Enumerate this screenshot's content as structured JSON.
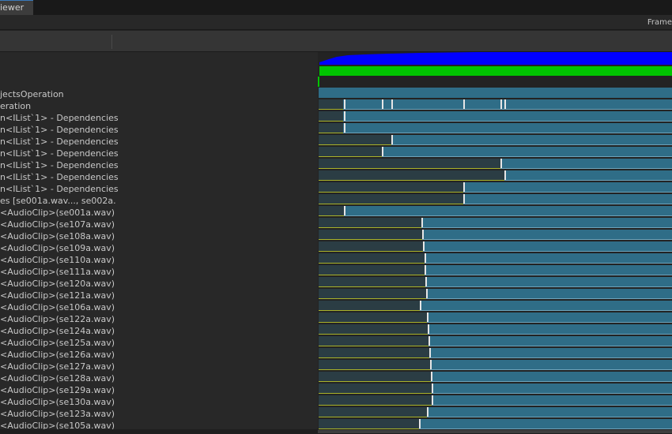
{
  "window": {
    "tab_title": "iewer",
    "frame_label": "Frame"
  },
  "colors": {
    "blue": "#0000ff",
    "green": "#00c400",
    "bar": "#2f6d87",
    "dark": "#2b3d44",
    "olive": "#aab32a"
  },
  "rows": [
    {
      "label": "jectsOperation",
      "end": 1.0,
      "ticks": []
    },
    {
      "label": "eration",
      "end": 1.0,
      "dark": 0.07,
      "ticks": [
        0.072,
        0.18,
        0.205,
        0.41,
        0.515,
        0.525
      ]
    },
    {
      "label": "n<IList`1> - Dependencies",
      "end": 1.0,
      "dark": 0.07,
      "ticks": [
        0.072
      ]
    },
    {
      "label": "n<IList`1> - Dependencies",
      "end": 1.0,
      "dark": 0.07,
      "ticks": [
        0.072
      ]
    },
    {
      "label": "n<IList`1> - Dependencies",
      "end": 1.0,
      "dark": 0.205,
      "ticks": [
        0.205
      ]
    },
    {
      "label": "n<IList`1> - Dependencies",
      "end": 1.0,
      "dark": 0.18,
      "ticks": [
        0.18
      ]
    },
    {
      "label": "n<IList`1> - Dependencies",
      "end": 1.0,
      "dark": 0.515,
      "ticks": [
        0.515
      ]
    },
    {
      "label": "n<IList`1> - Dependencies",
      "end": 1.0,
      "dark": 0.525,
      "ticks": [
        0.525
      ]
    },
    {
      "label": "n<IList`1> - Dependencies",
      "end": 1.0,
      "dark": 0.41,
      "ticks": [
        0.41
      ]
    },
    {
      "label": "es [se001a.wav..., se002a.",
      "end": 1.0,
      "dark": 0.41,
      "ticks": [
        0.41
      ]
    },
    {
      "label": "<AudioClip>(se001a.wav)",
      "end": 1.0,
      "dark": 0.072,
      "ticks": [
        0.072
      ]
    },
    {
      "label": "<AudioClip>(se107a.wav)",
      "end": 1.0,
      "dark": 0.29,
      "ticks": [
        0.29
      ]
    },
    {
      "label": "<AudioClip>(se108a.wav)",
      "end": 1.0,
      "dark": 0.293,
      "ticks": [
        0.293
      ]
    },
    {
      "label": "<AudioClip>(se109a.wav)",
      "end": 1.0,
      "dark": 0.296,
      "ticks": [
        0.296
      ]
    },
    {
      "label": "<AudioClip>(se110a.wav)",
      "end": 1.0,
      "dark": 0.299,
      "ticks": [
        0.299
      ]
    },
    {
      "label": "<AudioClip>(se111a.wav)",
      "end": 1.0,
      "dark": 0.3,
      "ticks": [
        0.3
      ]
    },
    {
      "label": "<AudioClip>(se120a.wav)",
      "end": 1.0,
      "dark": 0.302,
      "ticks": [
        0.302
      ]
    },
    {
      "label": "<AudioClip>(se121a.wav)",
      "end": 1.0,
      "dark": 0.304,
      "ticks": [
        0.304
      ]
    },
    {
      "label": "<AudioClip>(se106a.wav)",
      "end": 1.0,
      "dark": 0.287,
      "ticks": [
        0.287
      ]
    },
    {
      "label": "<AudioClip>(se122a.wav)",
      "end": 1.0,
      "dark": 0.306,
      "ticks": [
        0.306
      ]
    },
    {
      "label": "<AudioClip>(se124a.wav)",
      "end": 1.0,
      "dark": 0.309,
      "ticks": [
        0.309
      ]
    },
    {
      "label": "<AudioClip>(se125a.wav)",
      "end": 1.0,
      "dark": 0.311,
      "ticks": [
        0.311
      ]
    },
    {
      "label": "<AudioClip>(se126a.wav)",
      "end": 1.0,
      "dark": 0.313,
      "ticks": [
        0.313
      ]
    },
    {
      "label": "<AudioClip>(se127a.wav)",
      "end": 1.0,
      "dark": 0.315,
      "ticks": [
        0.315
      ]
    },
    {
      "label": "<AudioClip>(se128a.wav)",
      "end": 1.0,
      "dark": 0.317,
      "ticks": [
        0.317
      ]
    },
    {
      "label": "<AudioClip>(se129a.wav)",
      "end": 1.0,
      "dark": 0.319,
      "ticks": [
        0.319
      ]
    },
    {
      "label": "<AudioClip>(se130a.wav)",
      "end": 1.0,
      "dark": 0.321,
      "ticks": [
        0.321
      ]
    },
    {
      "label": "<AudioClip>(se123a.wav)",
      "end": 1.0,
      "dark": 0.307,
      "ticks": [
        0.307
      ]
    },
    {
      "label": "<AudioClip>(se105a.wav)",
      "end": 1.0,
      "dark": 0.283,
      "ticks": [
        0.283
      ]
    }
  ]
}
